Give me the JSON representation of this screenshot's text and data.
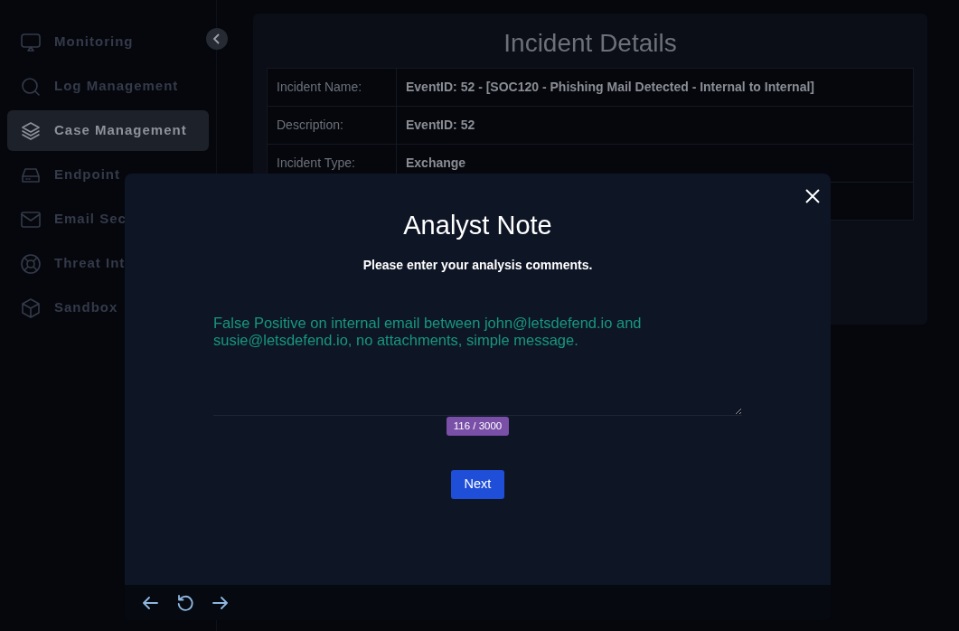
{
  "sidebar": {
    "items": [
      {
        "label": "Monitoring",
        "selected": false
      },
      {
        "label": "Log Management",
        "selected": false
      },
      {
        "label": "Case Management",
        "selected": true
      },
      {
        "label": "Endpoint",
        "selected": false
      },
      {
        "label": "Email Sec",
        "selected": false
      },
      {
        "label": "Threat Int",
        "selected": false
      },
      {
        "label": "Sandbox",
        "selected": false
      }
    ]
  },
  "incident": {
    "title": "Incident Details",
    "rows": [
      {
        "label": "Incident Name:",
        "value": "EventID: 52 - [SOC120 - Phishing Mail Detected - Internal to Internal]"
      },
      {
        "label": "Description:",
        "value": "EventID: 52"
      },
      {
        "label": "Incident Type:",
        "value": "Exchange"
      }
    ]
  },
  "modal": {
    "title": "Analyst Note",
    "subtitle": "Please enter your analysis comments.",
    "note": "False Positive on internal email between john@letsdefend.io and susie@letsdefend.io, no attachments, simple message.",
    "counter": "116 / 3000",
    "button": "Next"
  }
}
